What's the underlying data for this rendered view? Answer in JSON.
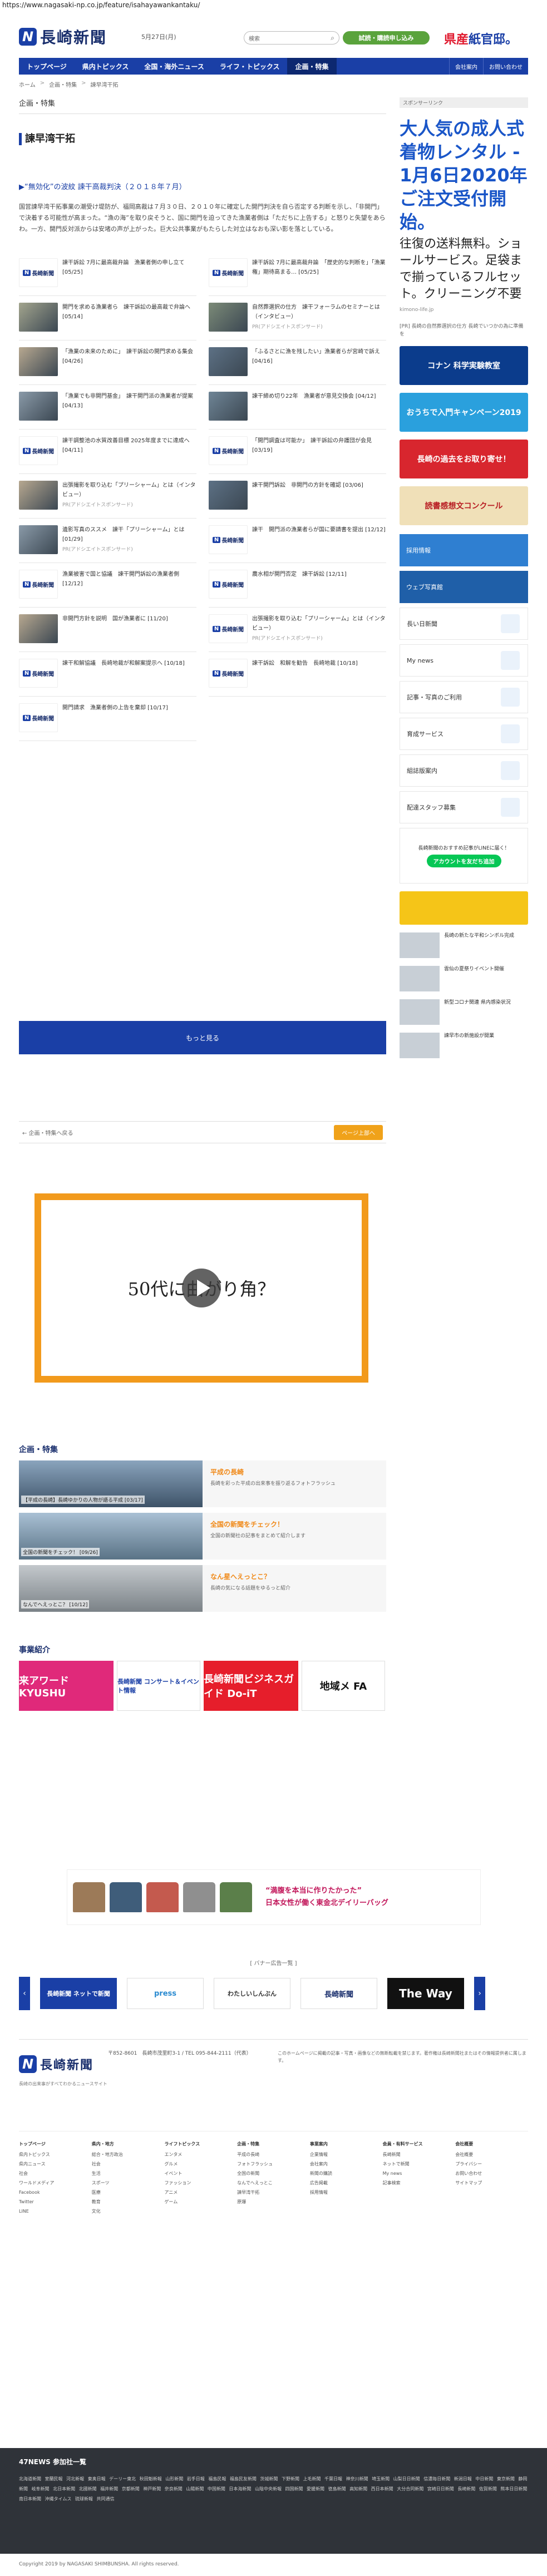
{
  "url": "https://www.nagasaki-np.co.jp/feature/isahayawankantaku/",
  "header": {
    "logo_mark": "N",
    "logo_text": "長崎新聞",
    "date": "5月27日(月)",
    "search_label": "検索",
    "search_placeholder": "",
    "subscribe": "試読・購読申し込み",
    "ad_text_a": "県産",
    "ad_text_b": "紙官邸。"
  },
  "nav": {
    "items": [
      "トップページ",
      "県内トピックス",
      "全国・海外ニュース",
      "ライフ・トピックス",
      "企画・特集"
    ],
    "right": [
      "会社案内",
      "お問い合わせ"
    ]
  },
  "breadcrumb": [
    "ホーム",
    "企画・特集",
    "諫早湾干拓"
  ],
  "main": {
    "section_label": "企画・特集",
    "title": "諫早湾干拓",
    "feature_link": "▶“無効化”の波紋 諫干高裁判決（２０１８年７月）",
    "intro": "国営諫早湾干拓事業の潮受け堤防が、福岡高裁は７月３０日、２０１０年に確定した開門判決を自ら否定する判断を示し、「非開門」で決着する可能性が高まった。“漁の海”を取り戻そうと、国に開門を迫ってきた漁業者側は「ただちに上告する」と怒りと失望をあらわ。一方、開門反対派からは安堵の声が上がった。巨大公共事業がもたらした対立はなおも深い影を落としている。",
    "cards": [
      {
        "text": "諫干訴訟 7月に最高裁弁論　漁業者側の申し立て [05/25]",
        "pr": "",
        "thumb": "logo"
      },
      {
        "text": "諫干訴訟 7月に最高裁弁論　「歴史的な判断を」「漁業権」期待高まる… [05/25]",
        "pr": "",
        "thumb": "logo"
      },
      {
        "text": "開門を求める漁業者ら　諫干訴訟の最高裁で弁論へ [05/14]",
        "pr": "",
        "thumb": "photo"
      },
      {
        "text": "自然葬選択の仕方　諫干フォーラムのセミナーとは（インタビュー）",
        "pr": "PR(アドシエイトスポンサード)",
        "thumb": "photo"
      },
      {
        "text": "「漁業の未来のために」　諫干訴訟の開門求める集会 [04/26]",
        "pr": "",
        "thumb": "photo"
      },
      {
        "text": "「ふるさとに漁を残したい」漁業者らが宮崎で訴え [04/16]",
        "pr": "",
        "thumb": "photo"
      },
      {
        "text": "「漁業でも非開門基金」　諫干開門派の漁業者が提案 [04/13]",
        "pr": "",
        "thumb": "photo"
      },
      {
        "text": "諫干締め切り22年　漁業者が意見交換会 [04/12]",
        "pr": "",
        "thumb": "photo"
      },
      {
        "text": "諫干調整池の水質改善目標 2025年度までに達成へ [04/11]",
        "pr": "",
        "thumb": "logo"
      },
      {
        "text": "「開門調査は可能か」　諫干訴訟の弁護団が会見 [03/19]",
        "pr": "",
        "thumb": "logo"
      },
      {
        "text": "出張撮影を取り込む「プリーシャーム」とは（インタビュー）",
        "pr": "PR(アドシエイトスポンサード)",
        "thumb": "photo"
      },
      {
        "text": "諫干開門訴訟　非開門の方針を確認 [03/06]",
        "pr": "",
        "thumb": "photo"
      },
      {
        "text": "遺影写真のススメ　諫干「プリーシャーム」とは [01/29]",
        "pr": "PR(アドシエイトスポンサード)",
        "thumb": "photo"
      },
      {
        "text": "諫干　開門派の漁業者らが国に要請書を提出 [12/12]",
        "pr": "",
        "thumb": "logo"
      },
      {
        "text": "漁業被害で国と協議　諫干開門訴訟の漁業者側 [12/12]",
        "pr": "",
        "thumb": "logo"
      },
      {
        "text": "農水相が開門否定　諫干訴訟 [12/11]",
        "pr": "",
        "thumb": "logo"
      },
      {
        "text": "非開門方針を説明　国が漁業者に [11/20]",
        "pr": "",
        "thumb": "photo"
      },
      {
        "text": "出張撮影を取り込む「プリーシャーム」とは（インタビュー）",
        "pr": "PR(アドシエイトスポンサード)",
        "thumb": "logo"
      },
      {
        "text": "諫干和解協議　長崎地裁が和解案提示へ [10/18]",
        "pr": "",
        "thumb": "logo"
      },
      {
        "text": "諫干訴訟　和解を勧告　長崎地裁 [10/18]",
        "pr": "",
        "thumb": "logo"
      },
      {
        "text": "開門請求　漁業者側の上告を棄却 [10/17]",
        "pr": "",
        "thumb": "logo"
      }
    ],
    "more": "もっと見る",
    "pager_back": "← 企画・特集へ戻る",
    "pager_top": "ページ上部へ",
    "video_text": "50代に曲がり角？"
  },
  "related": {
    "title": "企画・特集",
    "items": [
      {
        "cap": "【平成の長崎】長崎ゆかりの人物が語る平成 [03/17]",
        "head": "平成の長崎",
        "desc": "長崎を彩った平成の出来事を振り返るフォトフラッシュ"
      },
      {
        "cap": "全国の新聞をチェック！ [09/26]",
        "head": "全国の新聞をチェック！",
        "desc": "全国の新聞社の記事をまとめて紹介します"
      },
      {
        "cap": "なんでへえっとこ？ [10/12]",
        "head": "なん星へえっとこ？",
        "desc": "長崎の気になる話題をゆるっと紹介"
      }
    ],
    "biz_title": "事業紹介",
    "biz": [
      "来アワード KYUSHU",
      "長崎新聞 コンサート＆イベント情報",
      "長崎新聞ビジネスガイド Do-iT",
      "地域メ FA"
    ]
  },
  "side": {
    "sponsor": "スポンサーリンク",
    "ad_headline": "大人気の成人式着物レンタル - 1月6日2020年ご注文受付開始。",
    "ad_body": "往復の送料無料。ショールサービス。足袋まで揃っているフルセット。クリーニング不要",
    "ad_url": "kimono-life.jp",
    "note": "[PR] 長崎の自然葬選択の仕方 長崎でいつかの為に準備を",
    "banners": [
      "コナン 科学実験教室",
      "おうちで入門キャンペーン2019",
      "長崎の過去をお取り寄せ！",
      "読書感想文コンクール"
    ],
    "menu": [
      "採用情報",
      "ウェブ写真館",
      "長い日新聞",
      "My news",
      "記事・写真のご利用",
      "育成サービス",
      "組誌版案内",
      "配達スタッフ募集"
    ],
    "line_text": "長崎新聞のおすすめ記事がLINEに届く！",
    "line_btn": "アカウントを友だち追加",
    "ranking": [
      "長崎の新たな平和シンボル完成",
      "雲仙の夏祭りイベント開催",
      "新型コロナ関連 県内感染状況",
      "諫早市の新施設が開業"
    ]
  },
  "ad_band": {
    "copy1": "“満腹を本当に作りたかった”",
    "copy2": "日本女性が働く東金北デイリーバッグ"
  },
  "carousel": {
    "head": "[ バナー広告一覧 ]",
    "slides": [
      "長崎新聞 ネットで新聞",
      "press",
      "わたしいしんぶん",
      "長崎新聞",
      "The Way"
    ]
  },
  "footer": {
    "addr": "〒852-8601　長崎市茂里町3-1 / TEL 095-844-2111（代表）",
    "notes": "このホームページに掲載の記事・写真・画像などの無断転載を禁じます。著作権は長崎新聞社またはその情報提供者に属します。",
    "tag": "長崎の出来事がすべてわかるニュースサイト",
    "cols": [
      {
        "head": "トップページ",
        "items": [
          "県内トピックス",
          "県内ニュース",
          "社会",
          "ワールドメディア",
          "Facebook",
          "Twitter",
          "LINE"
        ]
      },
      {
        "head": "県内・地方",
        "items": [
          "総合・地方政治",
          "社会",
          "生活",
          "スポーツ",
          "医療",
          "教育",
          "文化"
        ]
      },
      {
        "head": "ライフトピックス",
        "items": [
          "エンタメ",
          "グルメ",
          "イベント",
          "ファッション",
          "アニメ",
          "ゲーム"
        ]
      },
      {
        "head": "企画・特集",
        "items": [
          "平成の長崎",
          "フォトフラッシュ",
          "全国の新聞",
          "なんでへえっとこ",
          "諫早湾干拓",
          "原爆"
        ]
      },
      {
        "head": "事業案内",
        "items": [
          "企業情報",
          "会社案内",
          "新聞の購読",
          "広告掲載",
          "採用情報"
        ]
      },
      {
        "head": "会員・有料サービス",
        "items": [
          "長崎新聞",
          "ネットで新聞",
          "My news",
          "記事検索"
        ]
      },
      {
        "head": "会社概要",
        "items": [
          "会社概要",
          "プライバシー",
          "お問い合わせ",
          "サイトマップ"
        ]
      }
    ]
  },
  "fournews": {
    "title": "47NEWS 参加社一覧",
    "links": "北海道新聞 室蘭民報 河北新報 東奥日報 デーリー東北 秋田魁新報 山形新聞 岩手日報 福島民報 福島民友新聞 茨城新聞 下野新聞 上毛新聞 千葉日報 神奈川新聞 埼玉新聞 山梨日日新聞 信濃毎日新聞 新潟日報 中日新聞 東京新聞 静岡新聞 岐阜新聞 北日本新聞 北國新聞 福井新聞 京都新聞 神戸新聞 奈良新聞 山陽新聞 中国新聞 日本海新聞 山陰中央新報 四国新聞 愛媛新聞 徳島新聞 高知新聞 西日本新聞 大分合同新聞 宮崎日日新聞 長崎新聞 佐賀新聞 熊本日日新聞 南日本新聞 沖縄タイムス 琉球新報 共同通信"
  },
  "copyright": "Copyright 2019 by NAGASAKI SHIMBUNSHA. All rights reserved."
}
